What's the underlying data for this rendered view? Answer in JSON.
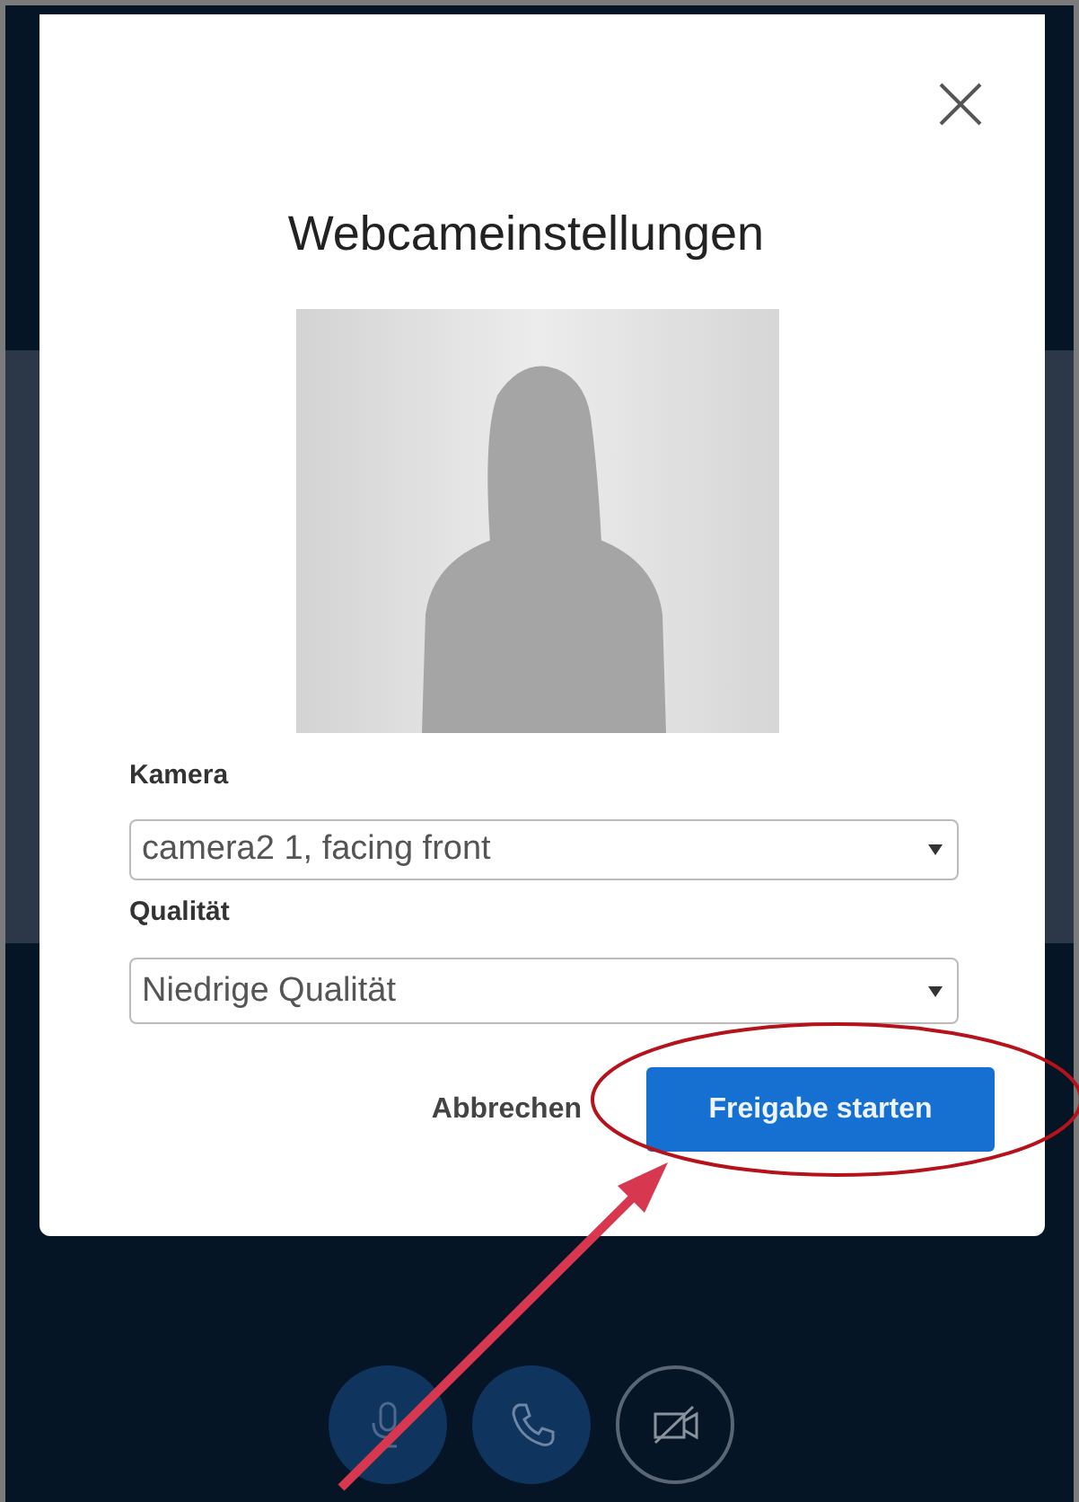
{
  "dialog": {
    "title": "Webcameinstellungen",
    "fields": [
      {
        "label": "Kamera",
        "value": "camera2 1, facing front"
      },
      {
        "label": "Qualität",
        "value": "Niedrige Qualität"
      }
    ],
    "buttons": [
      {
        "label": "Abbrechen",
        "kind": "secondary"
      },
      {
        "label": "Freigabe starten",
        "kind": "primary"
      }
    ]
  },
  "controls": [
    {
      "kind": "microphone",
      "on": true
    },
    {
      "kind": "phone",
      "on": true
    },
    {
      "kind": "camera",
      "on": false
    }
  ]
}
